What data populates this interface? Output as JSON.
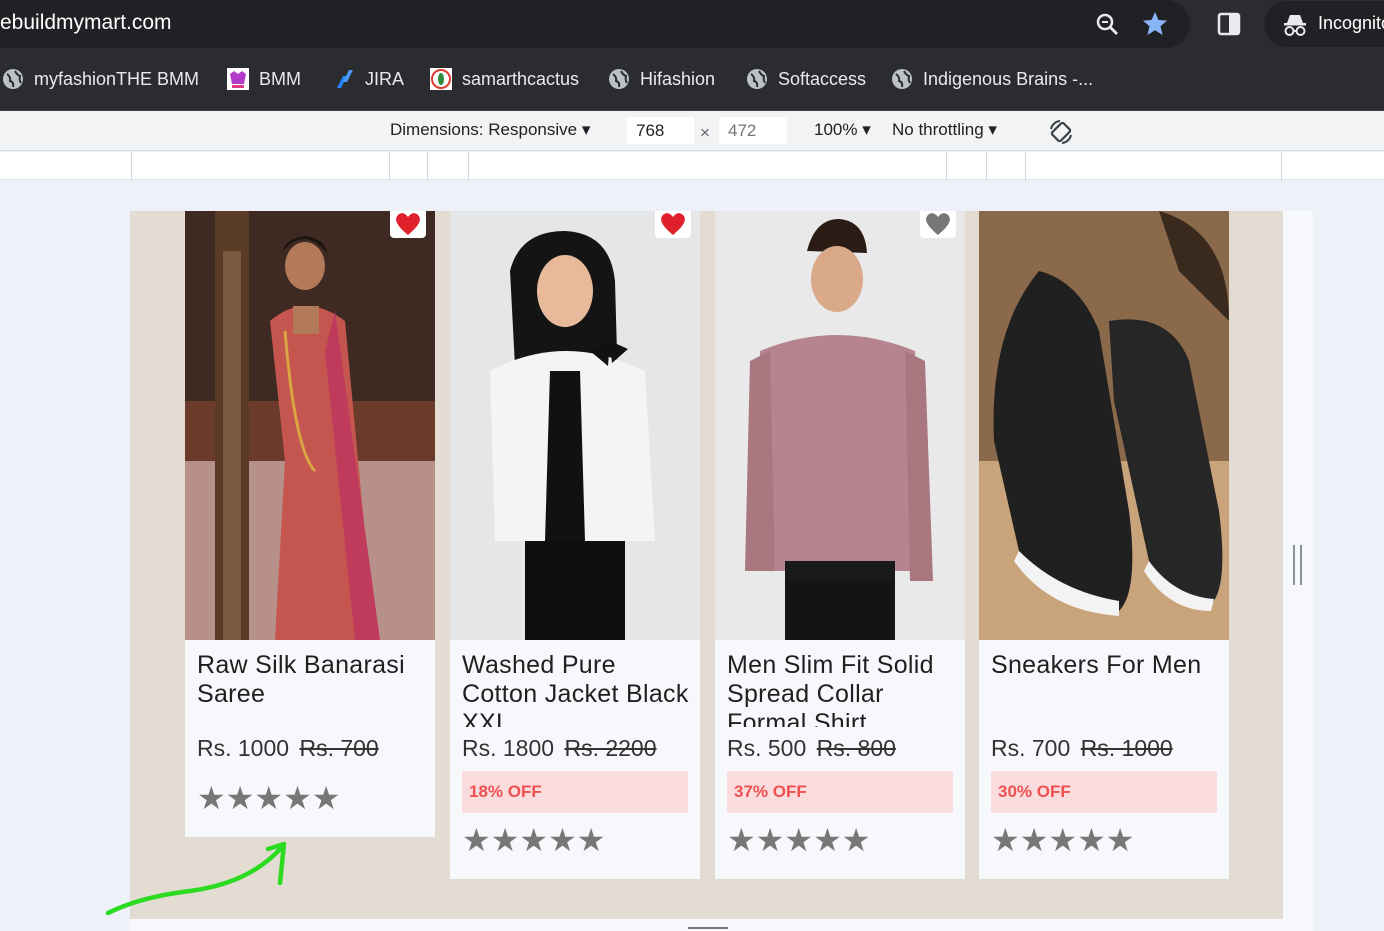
{
  "browser": {
    "url": "ebuildmymart.com",
    "incognito_label": "Incognito",
    "bookmarks": [
      {
        "label": "myfashionTHE BMM",
        "icon": "globe-icon"
      },
      {
        "label": "BMM",
        "icon": "bmm-logo-icon"
      },
      {
        "label": "JIRA",
        "icon": "jira-icon"
      },
      {
        "label": "samarthcactus",
        "icon": "cactus-icon"
      },
      {
        "label": "Hifashion",
        "icon": "globe-icon"
      },
      {
        "label": "Softaccess",
        "icon": "globe-icon"
      },
      {
        "label": "Indigenous Brains -...",
        "icon": "globe-icon"
      }
    ]
  },
  "devtools": {
    "dimensions_label": "Dimensions: Responsive",
    "width": "768",
    "height_placeholder": "472",
    "times": "×",
    "zoom": "100%",
    "throttling": "No throttling"
  },
  "products": [
    {
      "title": "Raw Silk Banarasi Saree",
      "price": "Rs. 1000",
      "old_price": "Rs. 700",
      "discount": "",
      "stars": "★★★★★",
      "wishlisted": true
    },
    {
      "title": "Washed Pure Cotton Jacket Black XXL",
      "price": "Rs. 1800",
      "old_price": "Rs. 2200",
      "discount": "18% OFF",
      "stars": "★★★★★",
      "wishlisted": true
    },
    {
      "title": "Men Slim Fit Solid Spread Collar Formal Shirt",
      "price": "Rs. 500",
      "old_price": "Rs. 800",
      "discount": "37% OFF",
      "stars": "★★★★★",
      "wishlisted": false
    },
    {
      "title": "Sneakers For Men",
      "price": "Rs. 700",
      "old_price": "Rs. 1000",
      "discount": "30% OFF",
      "stars": "★★★★★",
      "wishlisted": false
    }
  ],
  "colors": {
    "heart_active": "#e0202a",
    "heart_inactive": "#777777",
    "discount_bg": "#fbdcdc",
    "discount_text": "#ee5151",
    "annotation_arrow": "#2bdb1f"
  }
}
